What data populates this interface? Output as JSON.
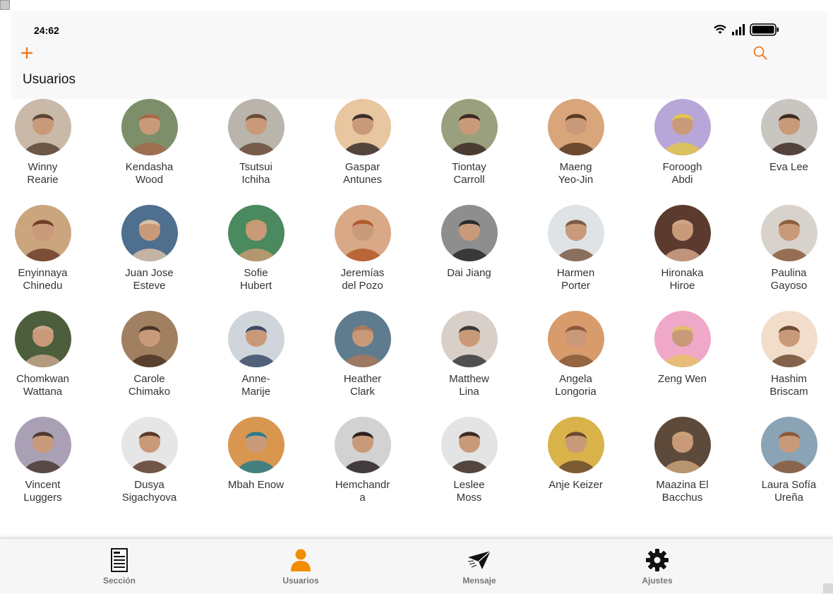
{
  "status_bar": {
    "time": "24:62"
  },
  "header": {
    "title": "Usuarios",
    "add_icon": "plus-icon",
    "search_icon": "search-icon",
    "accent_color": "#ee7b22"
  },
  "users": [
    {
      "name": "Winny\nRearie"
    },
    {
      "name": "Kendasha\nWood"
    },
    {
      "name": "Tsutsui\nIchiha"
    },
    {
      "name": "Gaspar\nAntunes"
    },
    {
      "name": "Tiontay\nCarroll"
    },
    {
      "name": "Maeng\nYeo-Jin"
    },
    {
      "name": "Foroogh\nAbdi"
    },
    {
      "name": "Eva Lee"
    },
    {
      "name": "Enyinnaya\nChinedu"
    },
    {
      "name": "Juan Jose\nEsteve"
    },
    {
      "name": "Sofie\nHubert"
    },
    {
      "name": "Jeremías\ndel Pozo"
    },
    {
      "name": "Dai Jiang"
    },
    {
      "name": "Harmen\nPorter"
    },
    {
      "name": "Hironaka\nHiroe"
    },
    {
      "name": "Paulina\nGayoso"
    },
    {
      "name": "Chomkwan\nWattana"
    },
    {
      "name": "Carole\nChimako"
    },
    {
      "name": "Anne-\nMarije"
    },
    {
      "name": "Heather\nClark"
    },
    {
      "name": "Matthew\nLina"
    },
    {
      "name": "Angela\nLongoria"
    },
    {
      "name": "Zeng Wen"
    },
    {
      "name": "Hashim\nBriscam"
    },
    {
      "name": "Vincent\nLuggers"
    },
    {
      "name": "Dusya\nSigachyova"
    },
    {
      "name": "Mbah Enow"
    },
    {
      "name": "Hemchandr\na"
    },
    {
      "name": "Leslee\nMoss"
    },
    {
      "name": "Anje Keizer"
    },
    {
      "name": "Maazina El\nBacchus"
    },
    {
      "name": "Laura Sofía\nUreña"
    }
  ],
  "tabbar": {
    "tabs": [
      {
        "label": "Sección",
        "icon": "document-icon"
      },
      {
        "label": "Usuarios",
        "icon": "user-icon",
        "active": true,
        "active_color": "#f28c00"
      },
      {
        "label": "Mensaje",
        "icon": "paper-plane-icon"
      },
      {
        "label": "Ajustes",
        "icon": "gear-icon"
      }
    ]
  }
}
